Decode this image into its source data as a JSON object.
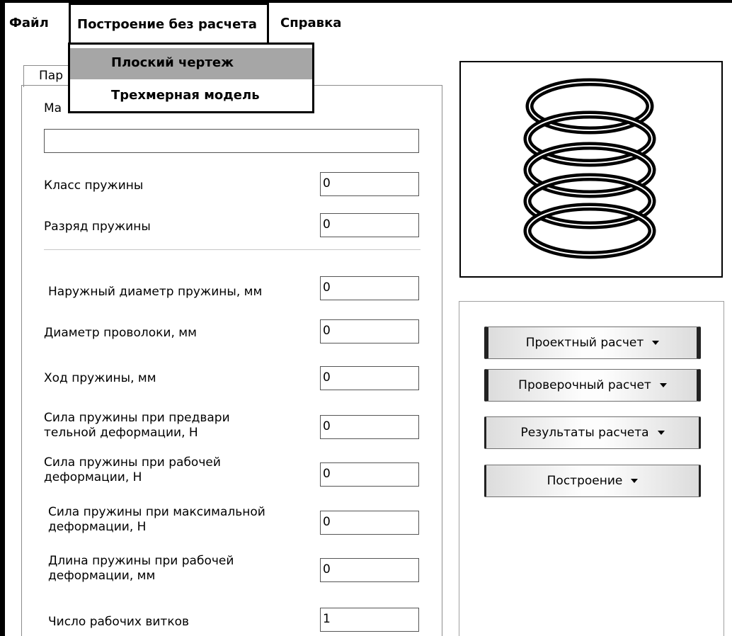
{
  "menu": {
    "file": "Файл",
    "build": "Построение без расчета",
    "help": "Справка",
    "dropdown": [
      "Плоский чертеж",
      "Трехмерная модель"
    ]
  },
  "tab": {
    "label": "Пар"
  },
  "form": {
    "material_label": "Ма",
    "material_value": "",
    "spring_class_label": "Класс пружины",
    "spring_class_value": "0",
    "spring_grade_label": "Разряд пружины",
    "spring_grade_value": "0",
    "outer_diameter_label": "Наружный диаметр пружины, мм",
    "outer_diameter_value": "0",
    "wire_diameter_label": "Диаметр проволоки, мм",
    "wire_diameter_value": "0",
    "stroke_label": "Ход пружины, мм",
    "stroke_value": "0",
    "pre_force_label_1": "Сила пружины при предвари",
    "pre_force_label_2": "тельной деформации, Н",
    "pre_force_value": "0",
    "work_force_label_1": "Сила пружины при рабочей",
    "work_force_label_2": "деформации, Н",
    "work_force_value": "0",
    "max_force_label_1": "Сила пружины при максимальной",
    "max_force_label_2": "деформации, Н",
    "max_force_value": "0",
    "work_length_label_1": "Длина пружины при рабочей",
    "work_length_label_2": "деформации, мм",
    "work_length_value": "0",
    "coils_label": "Число рабочих витков",
    "coils_value": "1"
  },
  "buttons": {
    "design": "Проектный расчет",
    "check": "Проверочный расчет",
    "results": "Результаты расчета",
    "build": "Построение"
  }
}
